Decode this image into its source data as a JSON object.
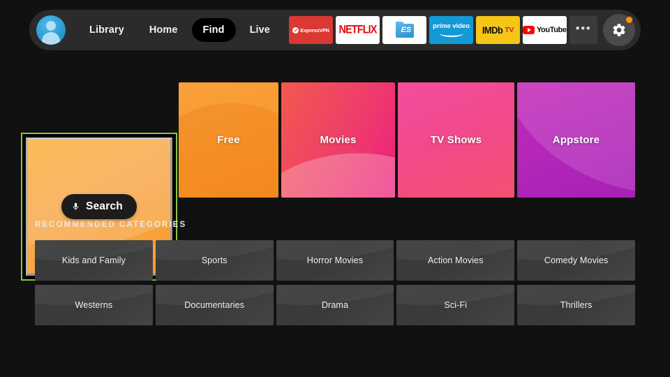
{
  "nav": {
    "avatar_name": "profile-avatar",
    "links": [
      {
        "label": "Library",
        "active": false
      },
      {
        "label": "Home",
        "active": false
      },
      {
        "label": "Find",
        "active": true
      },
      {
        "label": "Live",
        "active": false
      }
    ],
    "apps": [
      {
        "name": "expressvpn",
        "label": "ExpressVPN"
      },
      {
        "name": "netflix",
        "label": "NETFLIX"
      },
      {
        "name": "es-file-explorer",
        "label": "ES"
      },
      {
        "name": "prime-video",
        "label": "prime video"
      },
      {
        "name": "imdb-tv",
        "label": "IMDb",
        "label2": "TV"
      },
      {
        "name": "youtube",
        "label": "YouTube"
      }
    ],
    "overflow_label": "•••",
    "settings_label": "Settings",
    "notification_color": "#ff9500"
  },
  "hero": {
    "focus_color": "#8cc63f",
    "tiles": [
      {
        "label": "Search",
        "name": "search",
        "focused": true,
        "icon": "microphone-icon"
      },
      {
        "label": "Free",
        "name": "free",
        "focused": false
      },
      {
        "label": "Movies",
        "name": "movies",
        "focused": false
      },
      {
        "label": "TV Shows",
        "name": "tv-shows",
        "focused": false
      },
      {
        "label": "Appstore",
        "name": "appstore",
        "focused": false
      }
    ]
  },
  "recommended": {
    "heading": "RECOMMENDED CATEGORIES",
    "categories": [
      "Kids and Family",
      "Sports",
      "Horror Movies",
      "Action Movies",
      "Comedy Movies",
      "Westerns",
      "Documentaries",
      "Drama",
      "Sci-Fi",
      "Thrillers"
    ]
  }
}
